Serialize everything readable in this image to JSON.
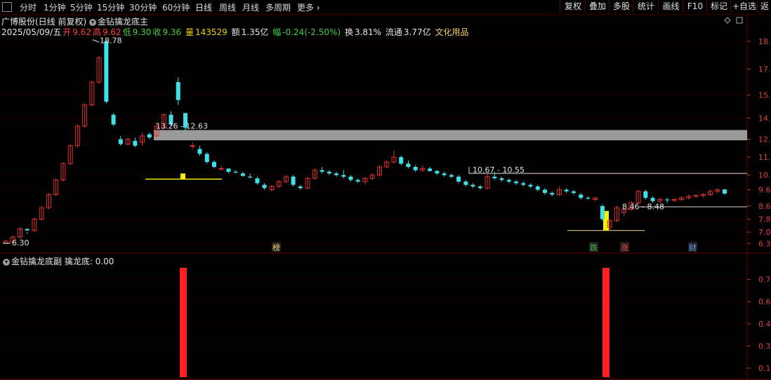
{
  "toolbar": {
    "periods": [
      "分时",
      "1分钟",
      "5分钟",
      "15分钟",
      "30分钟",
      "60分钟",
      "日线",
      "周线",
      "月线",
      "多周期",
      "更多"
    ],
    "active_period": "日线",
    "right_buttons": [
      "复权",
      "叠加",
      "多股",
      "统计",
      "画线",
      "F10",
      "标记",
      "+自选",
      "返"
    ]
  },
  "header": {
    "title": "广博股份(日线 前复权)",
    "indicator": "金钻擒龙底主",
    "date": "2025/05/09/五",
    "open_label": "开",
    "open": "9.62",
    "high_label": "高",
    "high": "9.62",
    "low_label": "低",
    "low": "9.30",
    "close_label": "收",
    "close": "9.36",
    "volume_label": "量",
    "volume": "143529",
    "amount_label": "额",
    "amount": "1.35亿",
    "change_label": "幅",
    "change": "-0.24(-2.50%)",
    "turnover_label": "换",
    "turnover": "3.81%",
    "float_label": "流通",
    "float": "3.77亿",
    "industry": "文化用品"
  },
  "subpanel": {
    "indicator": "金钻擒龙底副",
    "field_label": "擒龙底:",
    "field_value": "0.00"
  },
  "colors": {
    "up": "#e03030",
    "down": "#40e0e8",
    "grid": "#700000",
    "signal_bar": "#ff2020",
    "yellow": "#f0f000",
    "band": "#9a9a9a"
  },
  "chart_data": [
    {
      "type": "candlestick",
      "title": "广博股份(日线 前复权)",
      "y_axis_ticks": [
        "18.7",
        "17.0",
        "15.4",
        "14.0",
        "12.7",
        "11.6",
        "10.5",
        "9.6",
        "8.6",
        "7.8",
        "7.0",
        "6.3"
      ],
      "annotations": [
        "18.78",
        "13.26 - 12.63",
        "10.67 - 10.55",
        "8.46 - 8.48",
        "6.30"
      ],
      "markers": [
        {
          "label": "榜",
          "color": "#f0d060"
        },
        {
          "label": "跌",
          "color": "#40c040"
        },
        {
          "label": "涨",
          "color": "#ff4040"
        },
        {
          "label": "财",
          "color": "#60a0ff"
        }
      ],
      "bands": [
        {
          "label": "13.26 - 12.63",
          "y_range": [
            12.63,
            13.26
          ]
        },
        {
          "label": "10.67 - 10.55",
          "y_range": [
            10.55,
            10.67
          ]
        }
      ],
      "ohlc": [
        [
          6.3,
          6.5,
          6.3,
          6.45
        ],
        [
          6.4,
          6.8,
          6.3,
          6.7
        ],
        [
          6.7,
          7.3,
          6.6,
          7.2
        ],
        [
          7.2,
          7.0,
          6.9,
          7.1
        ],
        [
          7.1,
          7.9,
          7.0,
          7.8
        ],
        [
          7.8,
          8.6,
          7.7,
          8.5
        ],
        [
          8.5,
          9.4,
          8.4,
          9.3
        ],
        [
          9.3,
          10.3,
          9.2,
          10.2
        ],
        [
          10.2,
          11.3,
          10.1,
          11.2
        ],
        [
          11.2,
          12.4,
          11.1,
          12.3
        ],
        [
          12.3,
          13.6,
          12.2,
          13.5
        ],
        [
          13.5,
          14.9,
          13.4,
          14.8
        ],
        [
          14.8,
          16.3,
          14.7,
          16.2
        ],
        [
          16.2,
          17.8,
          16.1,
          17.7
        ],
        [
          18.7,
          18.8,
          14.9,
          15.0
        ],
        [
          14.2,
          14.3,
          13.5,
          13.6
        ],
        [
          12.7,
          12.9,
          12.3,
          12.4
        ],
        [
          12.4,
          12.8,
          12.3,
          12.7
        ],
        [
          12.6,
          12.8,
          12.2,
          12.3
        ],
        [
          12.5,
          13.1,
          12.3,
          12.9
        ],
        [
          13.0,
          13.1,
          12.7,
          12.8
        ],
        [
          12.9,
          13.7,
          12.8,
          13.5
        ],
        [
          13.4,
          14.3,
          13.3,
          14.2
        ],
        [
          14.2,
          14.4,
          13.5,
          13.6
        ],
        [
          16.2,
          16.5,
          14.8,
          15.1
        ],
        [
          14.3,
          14.3,
          13.2,
          13.4
        ],
        [
          12.3,
          12.5,
          12.1,
          12.3
        ],
        [
          12.1,
          12.3,
          11.7,
          11.8
        ],
        [
          11.8,
          11.9,
          11.2,
          11.3
        ],
        [
          11.3,
          11.4,
          10.9,
          11.0
        ],
        [
          10.9,
          11.1,
          10.8,
          10.9
        ],
        [
          10.9,
          10.9,
          10.6,
          10.7
        ],
        [
          10.7,
          10.8,
          10.6,
          10.65
        ],
        [
          10.6,
          10.7,
          10.4,
          10.45
        ],
        [
          10.4,
          10.6,
          10.3,
          10.35
        ],
        [
          10.3,
          10.4,
          9.9,
          10.0
        ],
        [
          9.9,
          10.0,
          9.6,
          9.7
        ],
        [
          9.6,
          9.9,
          9.5,
          9.8
        ],
        [
          9.8,
          10.2,
          9.7,
          10.1
        ],
        [
          10.1,
          10.5,
          10.0,
          10.4
        ],
        [
          10.4,
          10.5,
          9.8,
          9.9
        ],
        [
          9.8,
          9.9,
          9.6,
          9.7
        ],
        [
          9.7,
          10.4,
          9.6,
          10.3
        ],
        [
          10.3,
          10.9,
          10.2,
          10.8
        ],
        [
          10.8,
          11.0,
          10.6,
          10.7
        ],
        [
          10.7,
          10.8,
          10.5,
          10.6
        ],
        [
          10.6,
          10.7,
          10.4,
          10.5
        ],
        [
          10.5,
          10.8,
          10.3,
          10.4
        ],
        [
          10.4,
          10.5,
          10.1,
          10.2
        ],
        [
          10.2,
          10.3,
          10.0,
          10.1
        ],
        [
          10.1,
          10.4,
          9.9,
          10.3
        ],
        [
          10.3,
          10.6,
          10.2,
          10.5
        ],
        [
          10.5,
          11.1,
          10.4,
          11.0
        ],
        [
          11.0,
          11.4,
          10.9,
          11.3
        ],
        [
          11.3,
          12.0,
          11.2,
          11.6
        ],
        [
          11.6,
          11.7,
          11.1,
          11.2
        ],
        [
          11.2,
          11.4,
          10.9,
          11.0
        ],
        [
          11.0,
          11.1,
          10.7,
          10.8
        ],
        [
          10.8,
          11.1,
          10.7,
          10.9
        ],
        [
          10.9,
          11.0,
          10.7,
          10.75
        ],
        [
          10.75,
          10.8,
          10.5,
          10.6
        ],
        [
          10.6,
          10.7,
          10.4,
          10.5
        ],
        [
          10.5,
          10.6,
          10.3,
          10.4
        ],
        [
          10.4,
          10.5,
          10.0,
          10.1
        ],
        [
          10.1,
          10.2,
          9.8,
          9.9
        ],
        [
          9.9,
          10.0,
          9.7,
          9.8
        ],
        [
          9.8,
          9.9,
          9.6,
          9.7
        ],
        [
          9.7,
          10.6,
          9.6,
          10.4
        ],
        [
          10.4,
          10.7,
          10.2,
          10.3
        ],
        [
          10.3,
          10.4,
          10.1,
          10.2
        ],
        [
          10.2,
          10.3,
          10.0,
          10.1
        ],
        [
          10.1,
          10.2,
          9.9,
          10.0
        ],
        [
          10.0,
          10.1,
          9.8,
          9.9
        ],
        [
          9.9,
          10.0,
          9.7,
          9.8
        ],
        [
          9.8,
          9.9,
          9.5,
          9.6
        ],
        [
          9.6,
          9.7,
          9.3,
          9.4
        ],
        [
          9.4,
          9.5,
          9.2,
          9.3
        ],
        [
          9.3,
          9.8,
          9.2,
          9.6
        ],
        [
          9.6,
          9.7,
          9.4,
          9.5
        ],
        [
          9.5,
          9.6,
          9.3,
          9.4
        ],
        [
          9.3,
          9.4,
          9.0,
          9.1
        ],
        [
          9.1,
          9.2,
          9.0,
          9.05
        ],
        [
          9.0,
          9.15,
          8.9,
          9.1
        ],
        [
          8.6,
          8.7,
          7.7,
          7.8
        ],
        [
          7.3,
          7.8,
          7.1,
          7.7
        ],
        [
          7.7,
          8.6,
          7.6,
          8.5
        ],
        [
          8.2,
          8.5,
          8.0,
          8.4
        ],
        [
          8.4,
          8.9,
          8.3,
          8.8
        ],
        [
          8.8,
          9.6,
          8.7,
          9.5
        ],
        [
          9.5,
          9.6,
          9.0,
          9.1
        ],
        [
          9.1,
          9.2,
          8.8,
          8.9
        ],
        [
          8.9,
          9.1,
          8.8,
          9.0
        ],
        [
          9.0,
          9.1,
          8.8,
          8.95
        ],
        [
          8.95,
          9.05,
          8.85,
          9.0
        ],
        [
          9.0,
          9.2,
          8.9,
          9.1
        ],
        [
          9.1,
          9.3,
          9.0,
          9.2
        ],
        [
          9.2,
          9.3,
          9.1,
          9.25
        ],
        [
          9.25,
          9.4,
          9.1,
          9.3
        ],
        [
          9.3,
          9.6,
          9.2,
          9.5
        ],
        [
          9.5,
          9.7,
          9.4,
          9.6
        ],
        [
          9.62,
          9.62,
          9.3,
          9.36
        ]
      ]
    },
    {
      "type": "bar",
      "title": "金钻擒龙底副",
      "y_axis_ticks": [
        "0.7",
        "0.6",
        "0.4",
        "0.3",
        "0.1"
      ],
      "series": [
        {
          "name": "擒龙底",
          "values": [
            1,
            1
          ]
        }
      ]
    }
  ]
}
